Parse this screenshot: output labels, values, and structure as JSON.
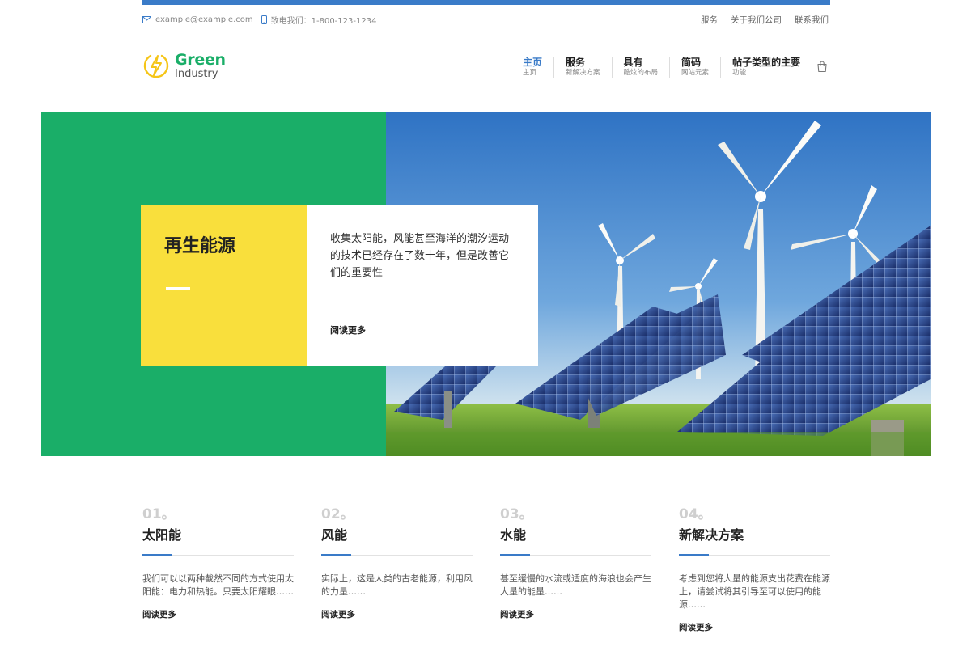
{
  "topbar": {
    "email": "example@example.com",
    "phone": "致电我们：1-800-123-1234",
    "links": [
      "服务",
      "关于我们公司",
      "联系我们"
    ]
  },
  "logo": {
    "line1": "Green",
    "line2": "Industry",
    "icon": "lightning-bolt-icon"
  },
  "nav": {
    "items": [
      {
        "title": "主页",
        "sub": "主页"
      },
      {
        "title": "服务",
        "sub": "新解决方案"
      },
      {
        "title": "具有",
        "sub": "酷炫的布局"
      },
      {
        "title": "简码",
        "sub": "网站元素"
      },
      {
        "title": "帖子类型的主要",
        "sub": "功能"
      }
    ],
    "cart_icon": "shopping-bag-icon"
  },
  "hero": {
    "heading": "再生能源",
    "description": "收集太阳能，风能甚至海洋的潮汐运动的技术已经存在了数十年，但是改善它们的重要性",
    "read_more": "阅读更多"
  },
  "features": [
    {
      "num": "01。",
      "title": "太阳能",
      "text": "我们可以以两种截然不同的方式使用太阳能：电力和热能。只要太阳耀眼……",
      "more": "阅读更多"
    },
    {
      "num": "02。",
      "title": "风能",
      "text": "实际上，这是人类的古老能源，利用风的力量……",
      "more": "阅读更多"
    },
    {
      "num": "03。",
      "title": "水能",
      "text": "甚至缓慢的水流或适度的海浪也会产生大量的能量……",
      "more": "阅读更多"
    },
    {
      "num": "04。",
      "title": "新解决方案",
      "text": "考虑到您将大量的能源支出花费在能源上，请尝试将其引导至可以使用的能源……",
      "more": "阅读更多"
    }
  ],
  "colors": {
    "brand_green": "#1aae68",
    "accent_blue": "#3a7bc8",
    "yellow": "#f9df3c"
  }
}
